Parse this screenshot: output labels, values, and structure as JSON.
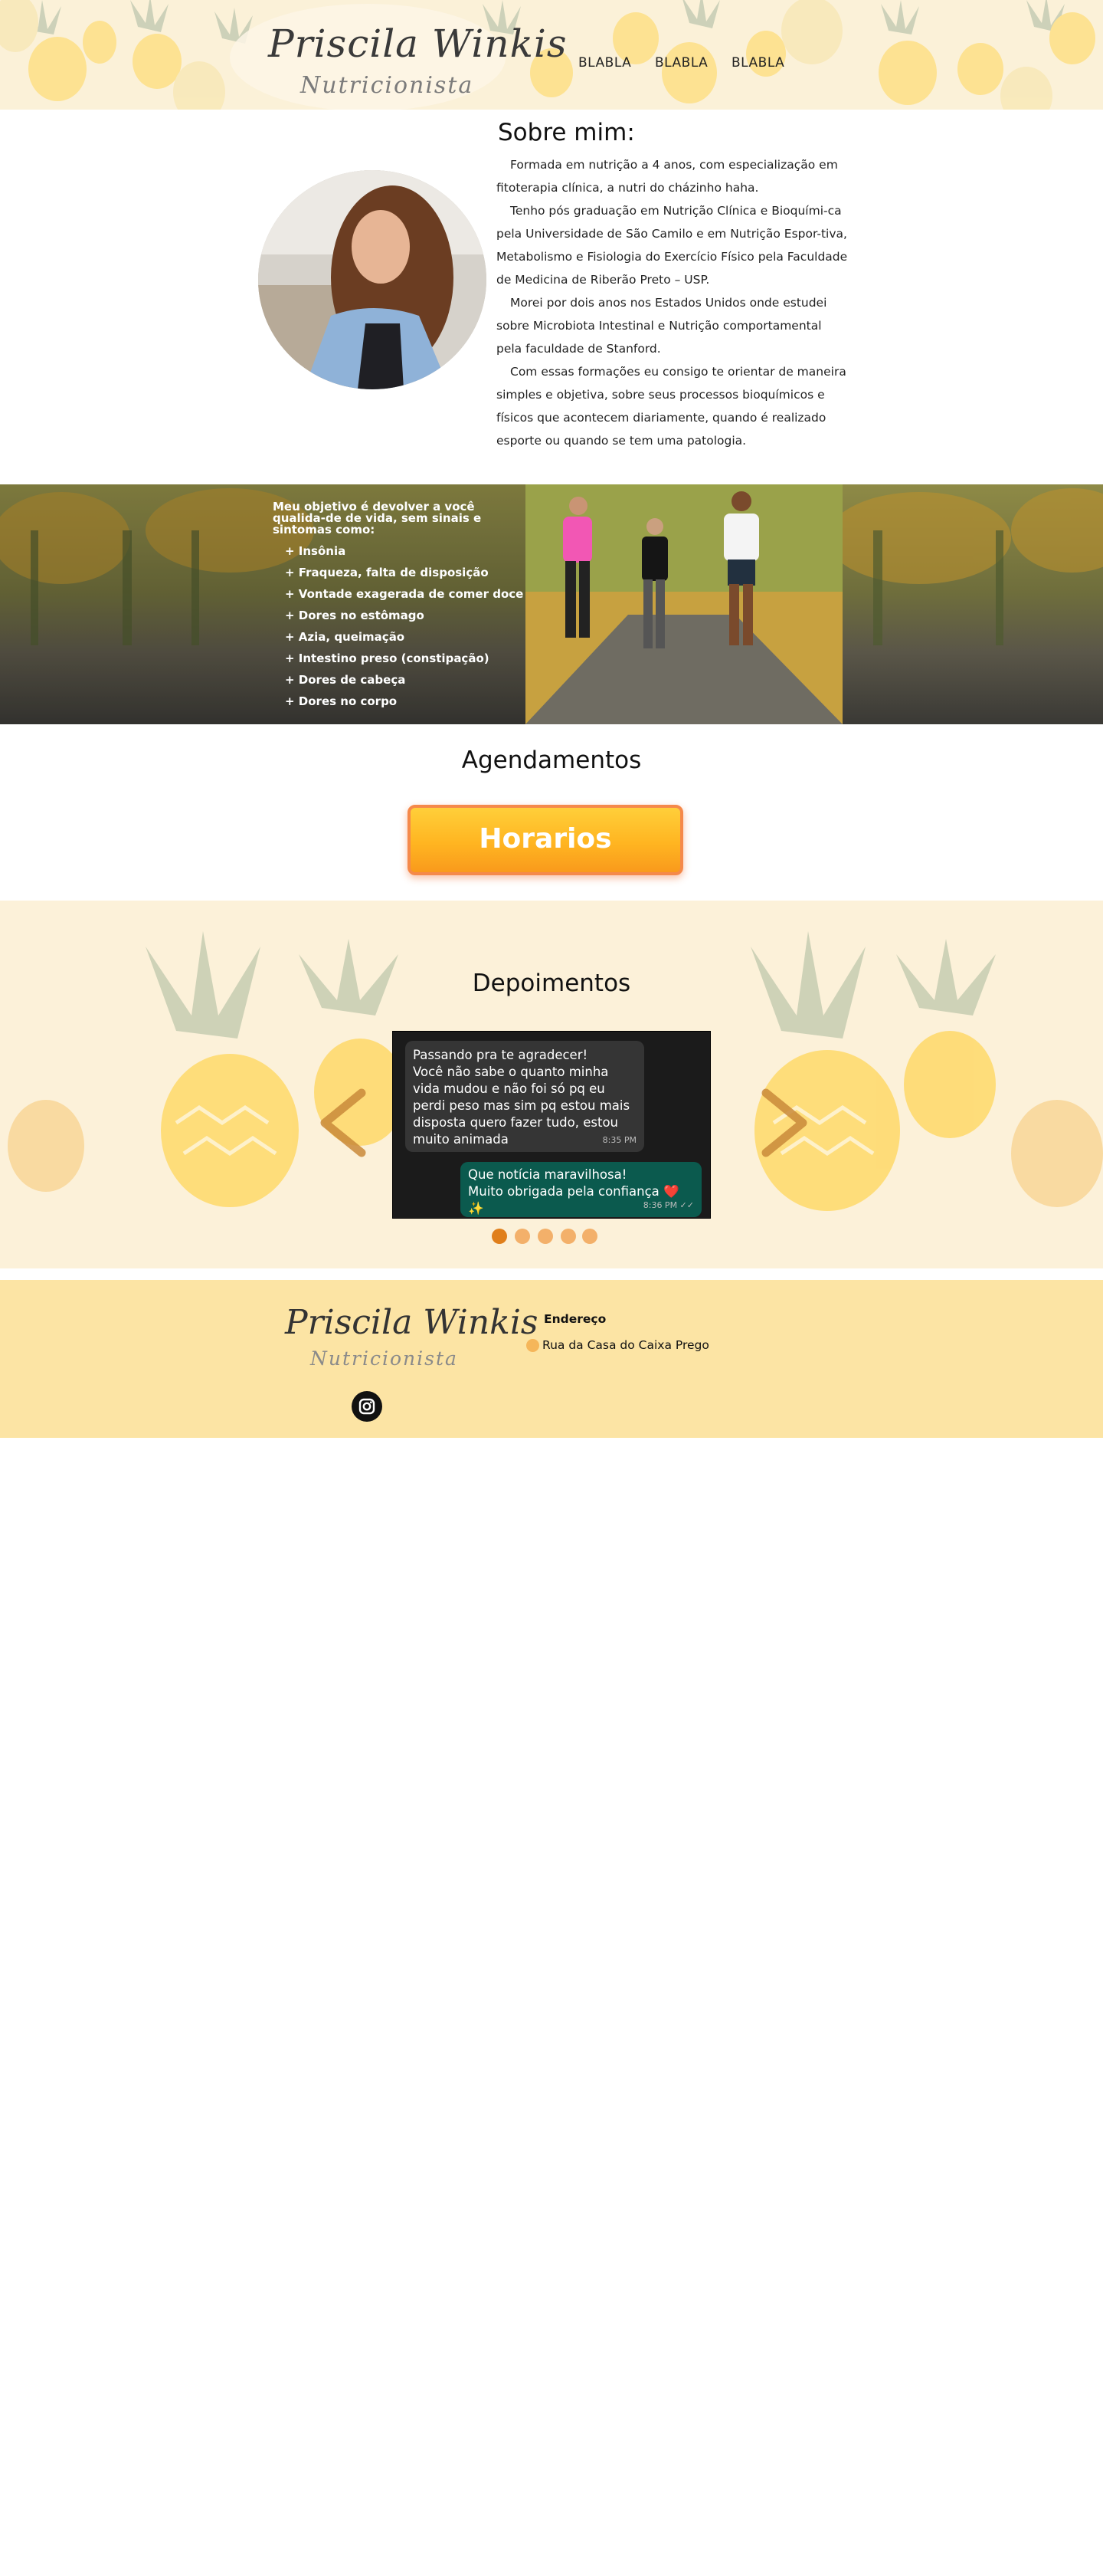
{
  "header": {
    "logo_title": "Priscila Winkis",
    "logo_subtitle": "Nutricionista",
    "nav": [
      "BLABLA",
      "BLABLA",
      "BLABLA"
    ]
  },
  "about": {
    "title": "Sobre mim:",
    "paragraphs": [
      "Formada em nutrição a 4 anos, com especialização em fitoterapia clínica, a nutri do cházinho haha.",
      "Tenho pós graduação em Nutrição Clínica e Bioquími-ca pela Universidade de São Camilo e em Nutrição Espor-tiva, Metabolismo e Fisiologia do Exercício Físico pela Faculdade de Medicina de Riberão Preto – USP.",
      "Morei por dois anos nos Estados Unidos onde estudei sobre Microbiota Intestinal e Nutrição comportamental pela faculdade de Stanford.",
      "Com essas formações eu consigo te orientar de maneira simples e objetiva, sobre seus processos bioquímicos e físicos que acontecem diariamente, quando é realizado esporte ou quando se tem uma patologia."
    ]
  },
  "objective": {
    "intro": "Meu objetivo é devolver a você qualida-de de vida, sem sinais e sintomas como:",
    "items": [
      "+ Insônia",
      "+ Fraqueza, falta de disposição",
      "+ Vontade exagerada de comer doce",
      "+ Dores no estômago",
      "+ Azia, queimação",
      "+ Intestino preso (constipação)",
      "+ Dores de cabeça",
      "+ Dores no corpo"
    ]
  },
  "schedule": {
    "title": "Agendamentos",
    "button_label": "Horarios"
  },
  "testimonials": {
    "title": "Depoimentos",
    "incoming_message": "Passando pra te agradecer!\nVocê não sabe o quanto minha vida mudou e não foi só pq eu perdi peso mas sim pq estou mais disposta quero fazer tudo, estou muito animada",
    "incoming_time": "8:35 PM",
    "outgoing_message": "Que notícia maravilhosa!\nMuito obrigada pela confiança ❤️ ✨",
    "outgoing_time": "8:36 PM ✓✓",
    "active_slide": 1,
    "slide_count": 5
  },
  "footer": {
    "logo_title": "Priscila Winkis",
    "logo_subtitle": "Nutricionista",
    "address_heading": "Endereço",
    "address": "Rua da Casa do Caixa Prego"
  },
  "colors": {
    "header_bg": "#fbf1d8",
    "footer_bg": "#fce4a4",
    "button_orange": "#ffb521",
    "dot_active": "#e07f1b",
    "dot_inactive": "#f3b06a",
    "chat_in": "#353535",
    "chat_out": "#0b5a4e"
  },
  "icons": {
    "carousel_prev": "chevron-left-icon",
    "carousel_next": "chevron-right-icon",
    "social": "instagram-icon",
    "address": "location-dot-icon"
  }
}
